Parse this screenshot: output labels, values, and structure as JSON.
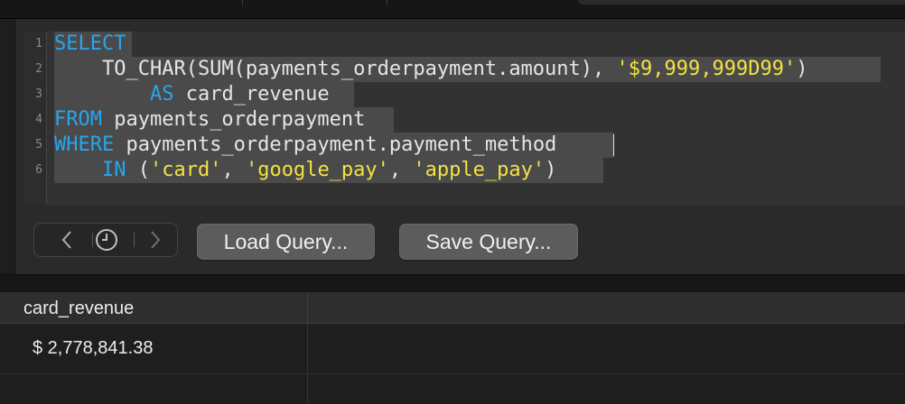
{
  "editor": {
    "line_numbers": [
      "1",
      "2",
      "3",
      "4",
      "5",
      "6"
    ],
    "lines": [
      [
        {
          "t": "SELECT",
          "c": "kw"
        }
      ],
      [
        {
          "t": "    TO_CHAR(SUM(payments_orderpayment.amount), ",
          "c": "plain"
        },
        {
          "t": "'$9,999,999D99'",
          "c": "str"
        },
        {
          "t": ")",
          "c": "plain"
        }
      ],
      [
        {
          "t": "        ",
          "c": "plain"
        },
        {
          "t": "AS",
          "c": "kw"
        },
        {
          "t": " card_revenue",
          "c": "plain"
        }
      ],
      [
        {
          "t": "FROM",
          "c": "kw"
        },
        {
          "t": " payments_orderpayment",
          "c": "plain"
        }
      ],
      [
        {
          "t": "WHERE",
          "c": "kw"
        },
        {
          "t": " payments_orderpayment.payment_method ",
          "c": "plain"
        }
      ],
      [
        {
          "t": "    ",
          "c": "plain"
        },
        {
          "t": "IN",
          "c": "kw"
        },
        {
          "t": " (",
          "c": "plain"
        },
        {
          "t": "'card'",
          "c": "str"
        },
        {
          "t": ", ",
          "c": "plain"
        },
        {
          "t": "'google_pay'",
          "c": "str"
        },
        {
          "t": ", ",
          "c": "plain"
        },
        {
          "t": "'apple_pay'",
          "c": "str"
        },
        {
          "t": ")",
          "c": "plain"
        }
      ]
    ]
  },
  "toolbar": {
    "back_icon": "chevron-left-icon",
    "history_icon": "clock-icon",
    "forward_icon": "chevron-right-icon",
    "load_label": "Load Query...",
    "save_label": "Save Query..."
  },
  "results": {
    "columns": [
      "card_revenue"
    ],
    "rows": [
      [
        "$ 2,778,841.38"
      ]
    ]
  },
  "colors": {
    "keyword": "#27a6ee",
    "string": "#f3e244",
    "text": "#e6e6e6",
    "selection": "#4a4a4a"
  }
}
